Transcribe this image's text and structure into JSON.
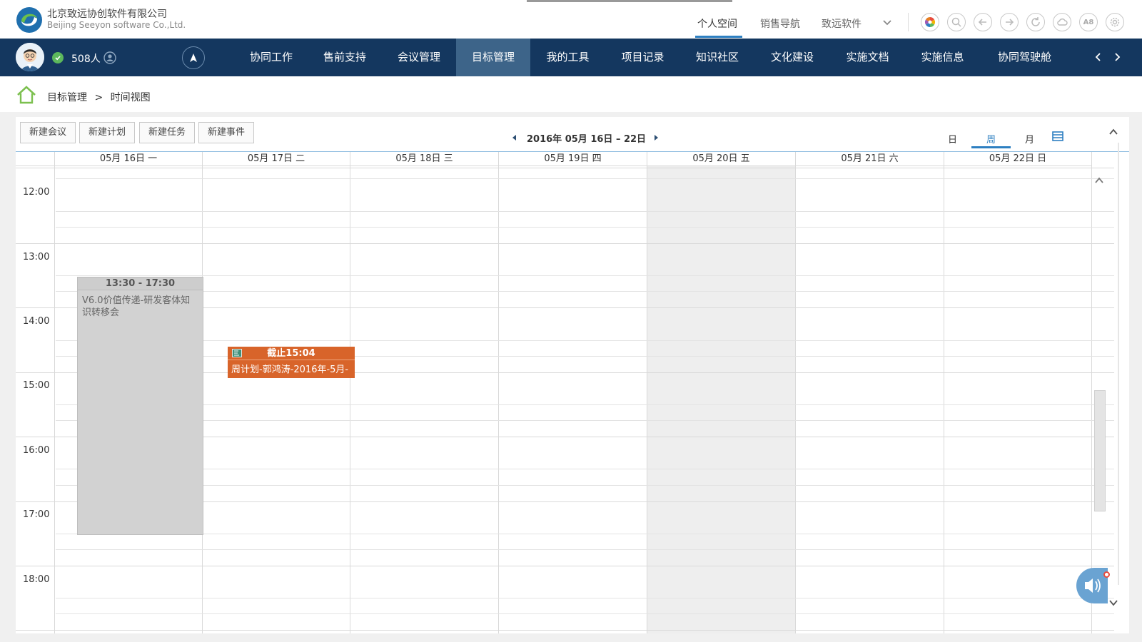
{
  "header": {
    "company_cn": "北京致远协创软件有限公司",
    "company_en": "Beijing Seeyon software Co.,Ltd.",
    "nav": [
      {
        "label": "个人空间",
        "active": true
      },
      {
        "label": "销售导航",
        "active": false
      },
      {
        "label": "致远软件",
        "active": false
      }
    ],
    "toolbar_icons": [
      "color-wheel-icon",
      "search-icon",
      "back-icon",
      "forward-icon",
      "refresh-icon",
      "cloud-icon",
      "font-size-icon",
      "settings-icon"
    ],
    "font_size_icon_text": "A8"
  },
  "menubar": {
    "online_count": "508人",
    "items": [
      {
        "label": "协同工作",
        "active": false
      },
      {
        "label": "售前支持",
        "active": false
      },
      {
        "label": "会议管理",
        "active": false
      },
      {
        "label": "目标管理",
        "active": true
      },
      {
        "label": "我的工具",
        "active": false
      },
      {
        "label": "项目记录",
        "active": false
      },
      {
        "label": "知识社区",
        "active": false
      },
      {
        "label": "文化建设",
        "active": false
      },
      {
        "label": "实施文档",
        "active": false
      },
      {
        "label": "实施信息",
        "active": false
      },
      {
        "label": "协同驾驶舱",
        "active": false
      }
    ],
    "background_color": "#14375f",
    "active_color": "#3d6489"
  },
  "breadcrumb": {
    "section": "目标管理",
    "separator": ">",
    "page": "时间视图"
  },
  "calendar": {
    "toolbar_buttons": [
      "新建会议",
      "新建计划",
      "新建任务",
      "新建事件"
    ],
    "date_range": "2016年 05月 16日 – 22日",
    "views": [
      {
        "label": "日",
        "active": false
      },
      {
        "label": "周",
        "active": true
      },
      {
        "label": "月",
        "active": false
      }
    ],
    "days": [
      "05月 16日 一",
      "05月 17日 二",
      "05月 18日 三",
      "05月 19日 四",
      "05月 20日 五",
      "05月 21日 六",
      "05月 22日 日"
    ],
    "highlighted_day": "05月 20日 五",
    "hours": [
      "12:00",
      "13:00",
      "14:00",
      "15:00",
      "16:00",
      "17:00",
      "18:00"
    ],
    "events": [
      {
        "day": "05月 16日 一",
        "type": "meeting",
        "time": "13:30 - 17:30",
        "title": "V6.0价值传递-研发客体知识转移会",
        "color": "#d2d2d2"
      },
      {
        "day": "05月 17日 二",
        "type": "plan",
        "time": "截止15:04",
        "title": "周计划-郭鸿涛-2016年-5月-",
        "color": "#d8642a"
      }
    ],
    "accent_color": "#2d7fc1"
  }
}
